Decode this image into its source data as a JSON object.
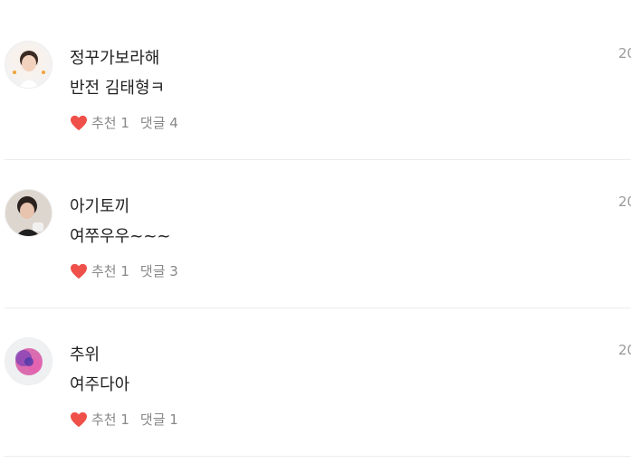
{
  "comments": [
    {
      "author": "정꾸가보라해",
      "date": "20",
      "text": "반전 김태형ㅋ",
      "likes_label": "추천 1",
      "replies_label": "댓글 4"
    },
    {
      "author": "아기토끼",
      "date": "20",
      "text": "여쭈우우~~~",
      "likes_label": "추천 1",
      "replies_label": "댓글 3"
    },
    {
      "author": "추위",
      "date": "20",
      "text": "여주다아",
      "likes_label": "추천 1",
      "replies_label": "댓글 1"
    }
  ],
  "colors": {
    "heart": "#f0504a",
    "divider": "#ececec"
  },
  "icons": [
    "heart-icon",
    "avatar"
  ]
}
